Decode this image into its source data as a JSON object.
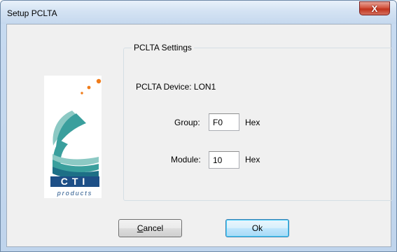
{
  "window": {
    "title": "Setup PCLTA",
    "close_glyph": "X"
  },
  "logo": {
    "brand": "CTI",
    "tagline": "products",
    "icon": "cti-products-logo",
    "colors": {
      "teal": "#3a9f9d",
      "navy": "#1d4f86",
      "orange": "#f07c1a"
    }
  },
  "settings": {
    "group_title": "PCLTA Settings",
    "device_label": "PCLTA Device: LON1",
    "group": {
      "label": "Group:",
      "value": "F0",
      "unit": "Hex"
    },
    "module": {
      "label": "Module:",
      "value": "10",
      "unit": "Hex"
    }
  },
  "buttons": {
    "cancel_mnemonic": "C",
    "cancel_rest": "ancel",
    "ok": "Ok"
  }
}
